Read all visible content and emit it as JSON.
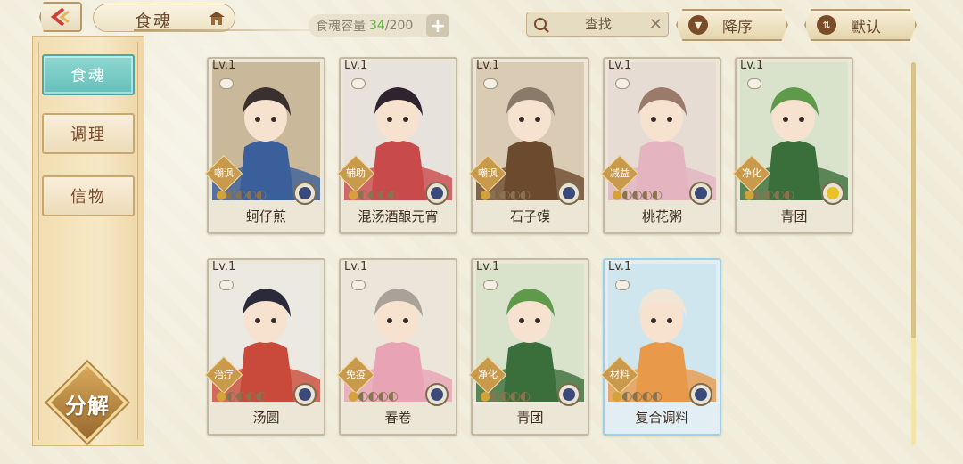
{
  "header": {
    "title": "食魂",
    "capacity_label": "食魂容量",
    "capacity_current": "34",
    "capacity_max": "/200",
    "search_placeholder": "查找",
    "sort_order_label": "降序",
    "sort_default_label": "默认"
  },
  "sidebar": {
    "items": [
      {
        "label": "食魂",
        "active": true
      },
      {
        "label": "调理",
        "active": false
      },
      {
        "label": "信物",
        "active": false
      }
    ],
    "decompose_label": "分解"
  },
  "cards": [
    {
      "level": "Lv.1",
      "name": "蚵仔煎",
      "role": "嘲讽",
      "stars_filled": 1,
      "stars_total": 5,
      "element_color": "#3b4a7a",
      "rare": false,
      "palette": [
        "#c9b89a",
        "#3a3030",
        "#3b5f9a"
      ]
    },
    {
      "level": "Lv.1",
      "name": "混汤酒酿元宵",
      "role": "辅助",
      "stars_filled": 1,
      "stars_total": 5,
      "element_color": "#3b4a7a",
      "rare": false,
      "palette": [
        "#e8e2dc",
        "#2e2430",
        "#c94a4a"
      ]
    },
    {
      "level": "Lv.1",
      "name": "石子馍",
      "role": "嘲讽",
      "stars_filled": 1,
      "stars_total": 5,
      "element_color": "#3b4a7a",
      "rare": false,
      "palette": [
        "#d9cbb4",
        "#8a7a6a",
        "#6b4a2e"
      ]
    },
    {
      "level": "Lv.1",
      "name": "桃花粥",
      "role": "减益",
      "stars_filled": 1,
      "stars_total": 5,
      "element_color": "#3b4a7a",
      "rare": false,
      "palette": [
        "#e6dcd4",
        "#9a7a6a",
        "#e4b4c0"
      ]
    },
    {
      "level": "Lv.1",
      "name": "青团",
      "role": "净化",
      "stars_filled": 1,
      "stars_total": 5,
      "element_color": "#e8c228",
      "rare": false,
      "palette": [
        "#d9e3cc",
        "#5e9a4a",
        "#3a6e3a"
      ]
    },
    {
      "level": "Lv.1",
      "name": "汤圆",
      "role": "治疗",
      "stars_filled": 1,
      "stars_total": 5,
      "element_color": "#3b4a7a",
      "rare": false,
      "palette": [
        "#ece8e2",
        "#2a2a3a",
        "#c94a3a"
      ]
    },
    {
      "level": "Lv.1",
      "name": "春卷",
      "role": "免疫",
      "stars_filled": 1,
      "stars_total": 5,
      "element_color": "#3b4a7a",
      "rare": false,
      "palette": [
        "#ece6da",
        "#a8a298",
        "#e8a4b4"
      ]
    },
    {
      "level": "Lv.1",
      "name": "青团",
      "role": "净化",
      "stars_filled": 1,
      "stars_total": 5,
      "element_color": "#3b4a7a",
      "rare": false,
      "palette": [
        "#d9e3cc",
        "#5e9a4a",
        "#3a6e3a"
      ]
    },
    {
      "level": "Lv.1",
      "name": "复合调料",
      "role": "材料",
      "stars_filled": 1,
      "stars_total": 5,
      "element_color": "#3b4a7a",
      "rare": true,
      "palette": [
        "#cfe6ef",
        "#f1e6d6",
        "#e89a4a"
      ]
    }
  ]
}
